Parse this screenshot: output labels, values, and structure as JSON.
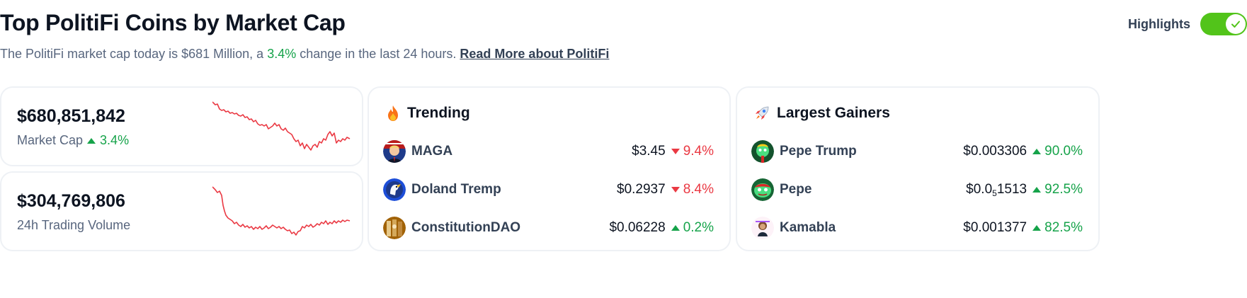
{
  "header": {
    "title": "Top PolitiFi Coins by Market Cap",
    "subtitle_prefix": "The PolitiFi market cap today is $681 Million, a",
    "subtitle_change": "3.4%",
    "subtitle_suffix": "change in the last 24 hours.",
    "read_more": "Read More about PolitiFi",
    "highlights_label": "Highlights",
    "highlights_on": true
  },
  "stats": {
    "market_cap": {
      "value": "$680,851,842",
      "label": "Market Cap",
      "change": "3.4%",
      "direction": "up"
    },
    "volume": {
      "value": "$304,769,806",
      "label": "24h Trading Volume"
    },
    "sparkline_color": "#ea3943"
  },
  "trending": {
    "title": "Trending",
    "icon": "fire-icon",
    "items": [
      {
        "name": "MAGA",
        "price": "$3.45",
        "change": "9.4%",
        "direction": "down"
      },
      {
        "name": "Doland Tremp",
        "price": "$0.2937",
        "change": "8.4%",
        "direction": "down"
      },
      {
        "name": "ConstitutionDAO",
        "price": "$0.06228",
        "change": "0.2%",
        "direction": "up"
      }
    ]
  },
  "gainers": {
    "title": "Largest Gainers",
    "icon": "rocket-icon",
    "items": [
      {
        "name": "Pepe Trump",
        "price": "$0.003306",
        "change": "90.0%",
        "direction": "up"
      },
      {
        "name": "Pepe",
        "price_prefix": "$0.0",
        "price_sub": "5",
        "price_suffix": "1513",
        "change": "92.5%",
        "direction": "up"
      },
      {
        "name": "Kamabla",
        "price": "$0.001377",
        "change": "82.5%",
        "direction": "up"
      }
    ]
  },
  "colors": {
    "up": "#16a34a",
    "down": "#ea3943",
    "toggle": "#52c41a"
  }
}
